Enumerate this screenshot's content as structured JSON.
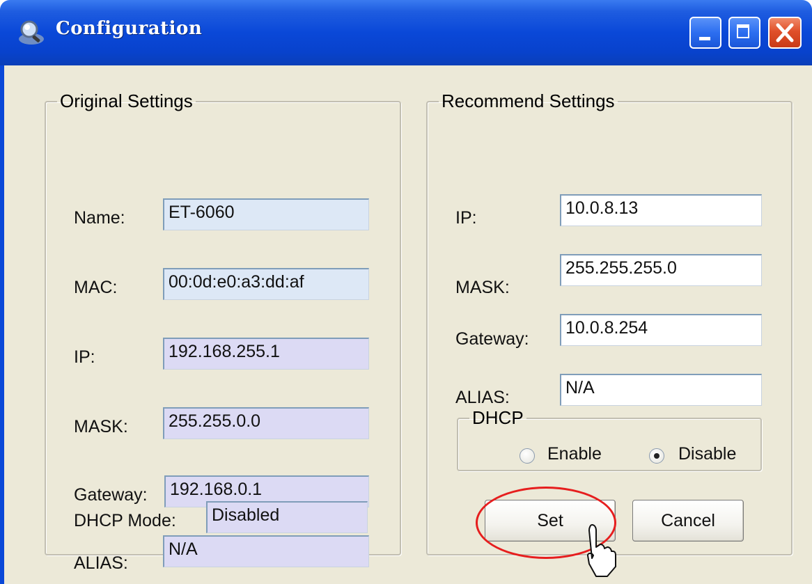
{
  "window": {
    "title": "Configuration",
    "colors": {
      "title_bar": "#0a48d8",
      "client_bg": "#ece9d8",
      "highlight": "#e61e1e"
    }
  },
  "original": {
    "legend": "Original Settings",
    "rows": [
      {
        "label": "Name:",
        "value": "ET-6060"
      },
      {
        "label": "MAC:",
        "value": "00:0d:e0:a3:dd:af"
      },
      {
        "label": "IP:",
        "value": "192.168.255.1"
      },
      {
        "label": "MASK:",
        "value": "255.255.0.0"
      },
      {
        "label": "Gateway:",
        "value": "192.168.0.1"
      },
      {
        "label": "ALIAS:",
        "value": "N/A"
      },
      {
        "label": "DHCP Mode:",
        "value": "Disabled"
      }
    ]
  },
  "recommend": {
    "legend": "Recommend Settings",
    "rows": [
      {
        "label": "IP:",
        "value": "10.0.8.13"
      },
      {
        "label": "MASK:",
        "value": "255.255.255.0"
      },
      {
        "label": "Gateway:",
        "value": "10.0.8.254"
      },
      {
        "label": "ALIAS:",
        "value": "N/A"
      }
    ],
    "dhcp": {
      "legend": "DHCP",
      "enable_label": "Enable",
      "disable_label": "Disable",
      "selected": "Disable"
    }
  },
  "buttons": {
    "set_label": "Set",
    "cancel_label": "Cancel"
  },
  "icons": [
    "magnifier-app-icon",
    "minimize-icon",
    "maximize-icon",
    "close-icon",
    "mouse-cursor-icon"
  ]
}
